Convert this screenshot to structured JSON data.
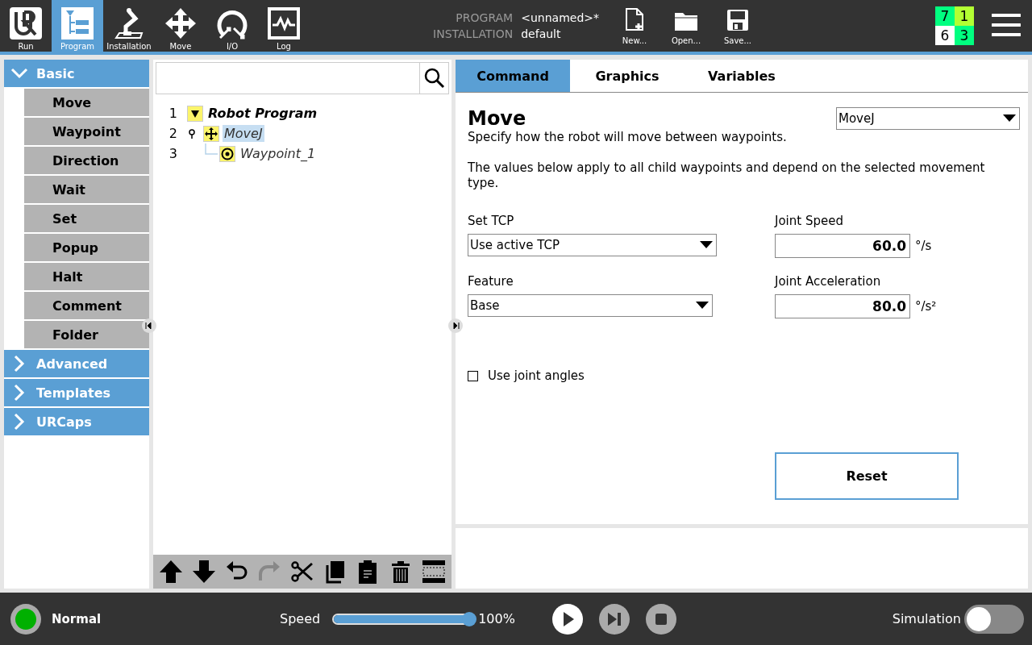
{
  "nav": [
    {
      "label": "Run",
      "kind": "logo",
      "selected": false
    },
    {
      "label": "Program",
      "kind": "program",
      "selected": true
    },
    {
      "label": "Installation",
      "kind": "installation",
      "selected": false
    },
    {
      "label": "Move",
      "kind": "move",
      "selected": false
    },
    {
      "label": "I/O",
      "kind": "io",
      "selected": false
    },
    {
      "label": "Log",
      "kind": "log",
      "selected": false
    }
  ],
  "program_info": [
    {
      "label": "PROGRAM",
      "value": "<unnamed>*"
    },
    {
      "label": "INSTALLATION",
      "value": "default"
    }
  ],
  "file_buttons": [
    {
      "label": "New...",
      "kind": "new"
    },
    {
      "label": "Open...",
      "kind": "open"
    },
    {
      "label": "Save...",
      "kind": "save"
    }
  ],
  "status_counts": [
    {
      "text": "7",
      "color": "#00ff80"
    },
    {
      "text": "1",
      "color": "#b3ff33"
    },
    {
      "text": "6",
      "color": "#ffffff"
    },
    {
      "text": "3",
      "color": "#00ff80"
    }
  ],
  "sidebar": [
    {
      "label": "Basic",
      "expanded": true,
      "children": [
        "Move",
        "Waypoint",
        "Direction",
        "Wait",
        "Set",
        "Popup",
        "Halt",
        "Comment",
        "Folder"
      ]
    },
    {
      "label": "Advanced",
      "expanded": false
    },
    {
      "label": "Templates",
      "expanded": false
    },
    {
      "label": "URCaps",
      "expanded": false
    }
  ],
  "tree": [
    {
      "line": "1",
      "label": "Robot Program",
      "kind": "root",
      "selected": false,
      "children": [
        {
          "line": "2",
          "label": "MoveJ",
          "kind": "move",
          "selected": true,
          "children": [
            {
              "line": "3",
              "label": "Waypoint_1",
              "kind": "waypoint",
              "selected": false
            }
          ]
        }
      ]
    }
  ],
  "toolbar": [
    {
      "kind": "up",
      "disabled": false
    },
    {
      "kind": "down",
      "disabled": false
    },
    {
      "kind": "undo",
      "disabled": false
    },
    {
      "kind": "redo",
      "disabled": true
    },
    {
      "kind": "cut",
      "disabled": false
    },
    {
      "kind": "copy",
      "disabled": false
    },
    {
      "kind": "paste",
      "disabled": false
    },
    {
      "kind": "delete",
      "disabled": false
    },
    {
      "kind": "suppress",
      "disabled": false
    }
  ],
  "tabs": [
    {
      "label": "Command",
      "selected": true
    },
    {
      "label": "Graphics",
      "selected": false
    },
    {
      "label": "Variables",
      "selected": false
    }
  ],
  "command": {
    "title": "Move",
    "move_type": "MoveJ",
    "description": "Specify how the robot will move between waypoints.",
    "note": "The values below apply to all child waypoints and depend on the selected movement type.",
    "set_tcp": {
      "label": "Set TCP",
      "value": "Use active TCP"
    },
    "feature": {
      "label": "Feature",
      "value": "Base"
    },
    "joint_speed": {
      "label": "Joint Speed",
      "value": "60.0",
      "unit": "°/s"
    },
    "joint_acceleration": {
      "label": "Joint Acceleration",
      "value": "80.0",
      "unit": "°/s²"
    },
    "joint_angles": {
      "label": "Use joint angles",
      "checked": false
    },
    "reset": "Reset"
  },
  "footer": {
    "status": "Normal",
    "speed": {
      "label": "Speed",
      "level": 1.0,
      "reading": "100%"
    },
    "controls": [
      {
        "kind": "play",
        "disabled": false
      },
      {
        "kind": "step",
        "disabled": true
      },
      {
        "kind": "stop",
        "disabled": true
      }
    ],
    "simulation": {
      "label": "Simulation",
      "on": false
    }
  }
}
